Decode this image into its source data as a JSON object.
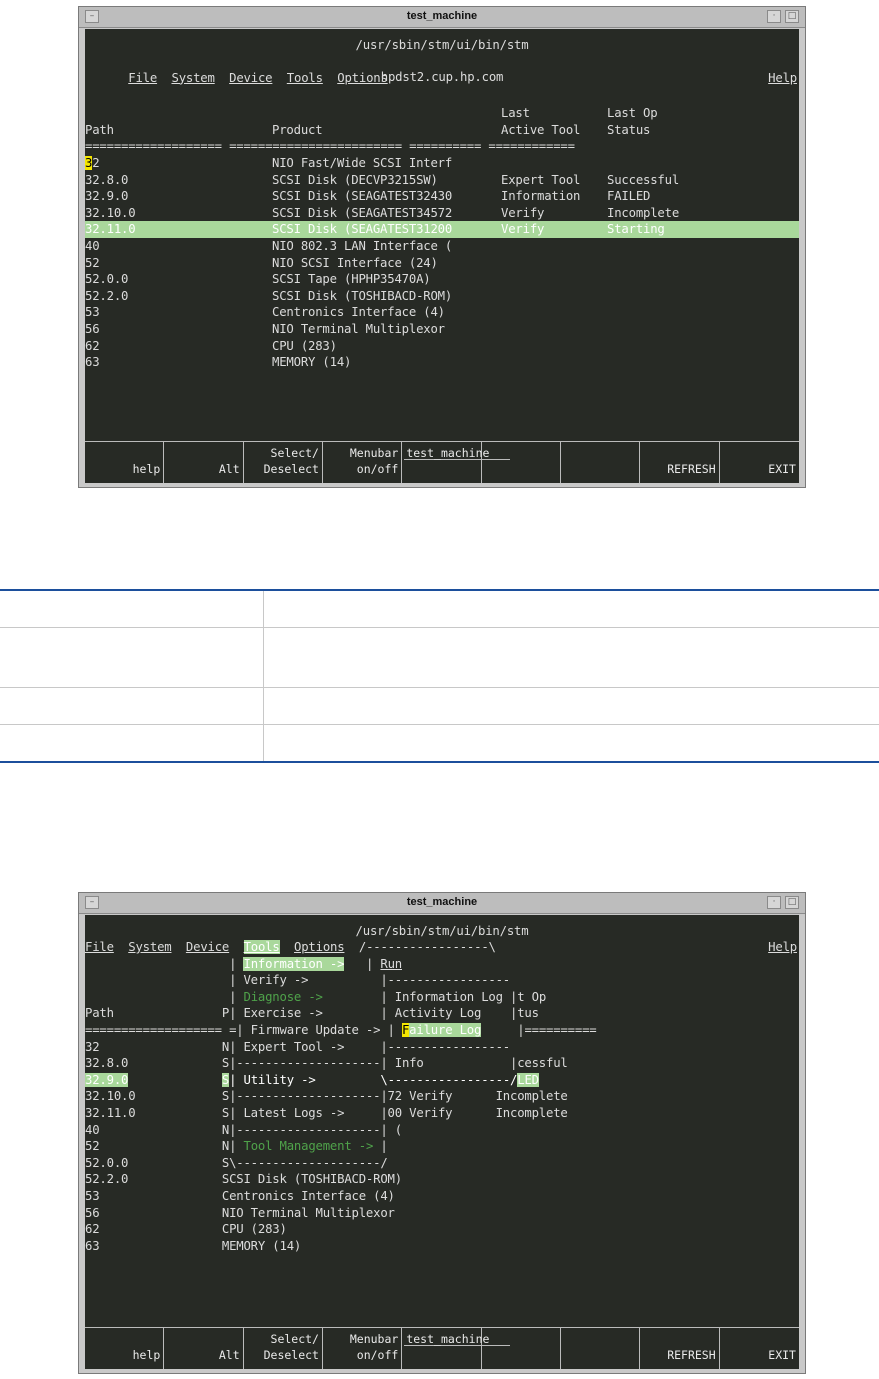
{
  "window_title": "test_machine",
  "program_path": "/usr/sbin/stm/ui/bin/stm",
  "hostname": "hpdst2.cup.hp.com",
  "menubar": {
    "items": [
      "File",
      "System",
      "Device",
      "Tools",
      "Options"
    ],
    "help": "Help"
  },
  "columns": {
    "last": "Last",
    "last_op": "Last Op",
    "path": "Path",
    "product": "Product",
    "active_tool": "Active Tool",
    "status": "Status"
  },
  "separator_line": "=================== ======================== ========== ============",
  "devices": [
    {
      "path": "32",
      "product": "NIO Fast/Wide SCSI Interf",
      "tool": "",
      "status": ""
    },
    {
      "path": "32.8.0",
      "product": "SCSI Disk (DECVP3215SW)",
      "tool": "Expert Tool",
      "status": "Successful"
    },
    {
      "path": "32.9.0",
      "product": "SCSI Disk (SEAGATEST32430",
      "tool": "Information",
      "status": "FAILED"
    },
    {
      "path": "32.10.0",
      "product": "SCSI Disk (SEAGATEST34572",
      "tool": "Verify",
      "status": "Incomplete"
    },
    {
      "path": "32.11.0",
      "product": "SCSI Disk (SEAGATEST31200",
      "tool": "Verify",
      "status": "Starting"
    },
    {
      "path": "40",
      "product": "NIO 802.3 LAN Interface (",
      "tool": "",
      "status": ""
    },
    {
      "path": "52",
      "product": "NIO SCSI Interface (24)",
      "tool": "",
      "status": ""
    },
    {
      "path": "52.0.0",
      "product": "SCSI Tape (HPHP35470A)",
      "tool": "",
      "status": ""
    },
    {
      "path": "52.2.0",
      "product": "SCSI Disk (TOSHIBACD-ROM)",
      "tool": "",
      "status": ""
    },
    {
      "path": "53",
      "product": "Centronics Interface (4)",
      "tool": "",
      "status": ""
    },
    {
      "path": "56",
      "product": "NIO Terminal Multiplexor",
      "tool": "",
      "status": ""
    },
    {
      "path": "62",
      "product": "CPU (283)",
      "tool": "",
      "status": ""
    },
    {
      "path": "63",
      "product": "MEMORY (14)",
      "tool": "",
      "status": ""
    }
  ],
  "fkeys": [
    {
      "l1": "",
      "l2": "help"
    },
    {
      "l1": "",
      "l2": "Alt"
    },
    {
      "l1": "Select/",
      "l2": "Deselect"
    },
    {
      "l1": "Menubar",
      "l2": "on/off"
    },
    {
      "l1": "test_machine",
      "l2": ""
    },
    {
      "l1": "",
      "l2": ""
    },
    {
      "l1": "",
      "l2": ""
    },
    {
      "l1": "",
      "l2": "REFRESH"
    },
    {
      "l1": "",
      "l2": "EXIT"
    }
  ],
  "screen2": {
    "lines": [
      {
        "t": "File  System  Device  Tools  Options  /-----------------\\           Help",
        "menu": true
      },
      {
        "segs": [
          [
            "                    | "
          ],
          [
            "Information ->",
            "hl"
          ],
          [
            "   | "
          ],
          [
            "Run",
            "ul"
          ]
        ]
      },
      {
        "segs": [
          [
            "                    | Verify ->          |-----------------"
          ]
        ]
      },
      {
        "segs": [
          [
            "                    | "
          ],
          [
            "Diagnose ->",
            "dim"
          ],
          [
            "        | Information Log |t Op"
          ]
        ]
      },
      {
        "segs": [
          [
            "Path               P| Exercise ->        | Activity Log    |tus"
          ]
        ]
      },
      {
        "segs": [
          [
            "=================== =| Firmware Update -> | "
          ],
          [
            "F",
            "cur"
          ],
          [
            "ailure Log",
            "hl"
          ],
          [
            "     |=========="
          ]
        ]
      },
      {
        "segs": [
          [
            "32                 N| Expert Tool ->     |-----------------"
          ]
        ]
      },
      {
        "segs": [
          [
            "32.8.0             S|--------------------| Info            |cessful"
          ]
        ]
      },
      {
        "segs": [
          [
            "32.9.0",
            "hl"
          ],
          [
            "             "
          ],
          [
            "S",
            "hl"
          ],
          [
            "| Utility ->         \\-----------------/"
          ],
          [
            "LED",
            "hl"
          ]
        ],
        "selrow": true
      },
      {
        "segs": [
          [
            "32.10.0            S|--------------------|72 Verify      Incomplete"
          ]
        ]
      },
      {
        "segs": [
          [
            "32.11.0            S| Latest Logs ->     |00 Verify      Incomplete"
          ]
        ]
      },
      {
        "segs": [
          [
            "40                 N|--------------------| ("
          ]
        ]
      },
      {
        "segs": [
          [
            "52                 N| "
          ],
          [
            "Tool Management ->",
            "dim"
          ],
          [
            " |"
          ]
        ]
      },
      {
        "segs": [
          [
            "52.0.0             S\\--------------------/"
          ]
        ]
      },
      {
        "segs": [
          [
            "52.2.0             SCSI Disk (TOSHIBACD-ROM)"
          ]
        ]
      },
      {
        "segs": [
          [
            "53                 Centronics Interface (4)"
          ]
        ]
      },
      {
        "segs": [
          [
            "56                 NIO Terminal Multiplexor"
          ]
        ]
      },
      {
        "segs": [
          [
            "62                 CPU (283)"
          ]
        ]
      },
      {
        "segs": [
          [
            "63                 MEMORY (14)"
          ]
        ]
      }
    ]
  }
}
